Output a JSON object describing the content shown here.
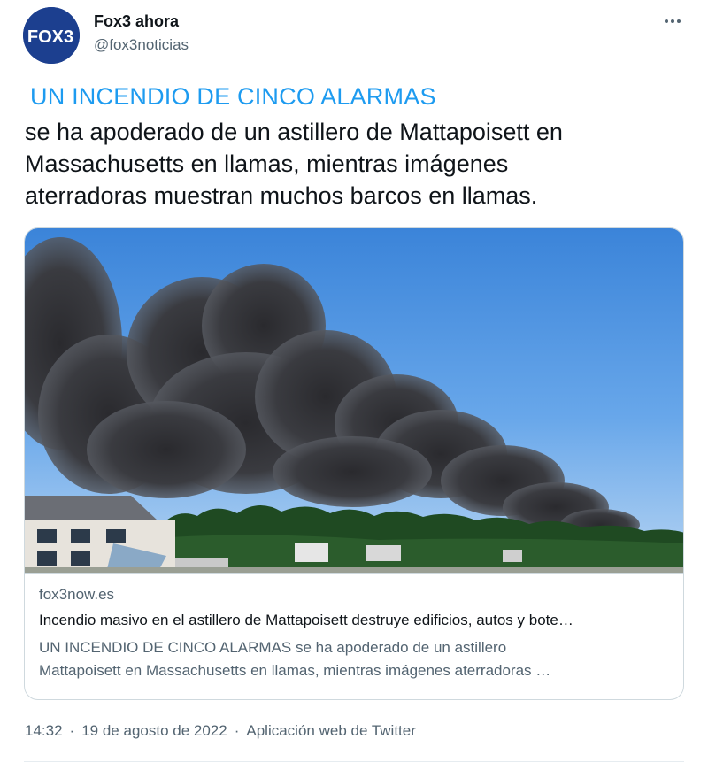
{
  "account": {
    "display_name": "Fox3 ahora",
    "handle": "@fox3noticias",
    "avatar_text": "FOX3"
  },
  "tweet": {
    "headline": "UN INCENDIO DE CINCO ALARMAS",
    "body_lines": [
      "se ha apoderado de un astillero de Mattapoisett en",
      "Massachusetts en llamas, mientras imágenes",
      "aterradoras muestran muchos barcos en llamas."
    ]
  },
  "card": {
    "domain": "fox3now.es",
    "title": "Incendio masivo en el astillero de Mattapoisett destruye edificios, autos y bote…",
    "description_lines": [
      "UN INCENDIO DE CINCO ALARMAS se ha apoderado de un astillero",
      "Mattapoisett en Massachusetts en llamas, mientras imágenes aterradoras …"
    ]
  },
  "meta": {
    "time": "14:32",
    "date": "19 de agosto de 2022",
    "separator": "·",
    "source": "Aplicación web de Twitter"
  },
  "icons": {
    "more": "more-horizontal-icon"
  },
  "colors": {
    "link_blue": "#1d9bf0",
    "text_primary": "#0f1419",
    "text_secondary": "#536471",
    "border": "#cfd9de",
    "avatar_bg": "#1c3f8f"
  }
}
